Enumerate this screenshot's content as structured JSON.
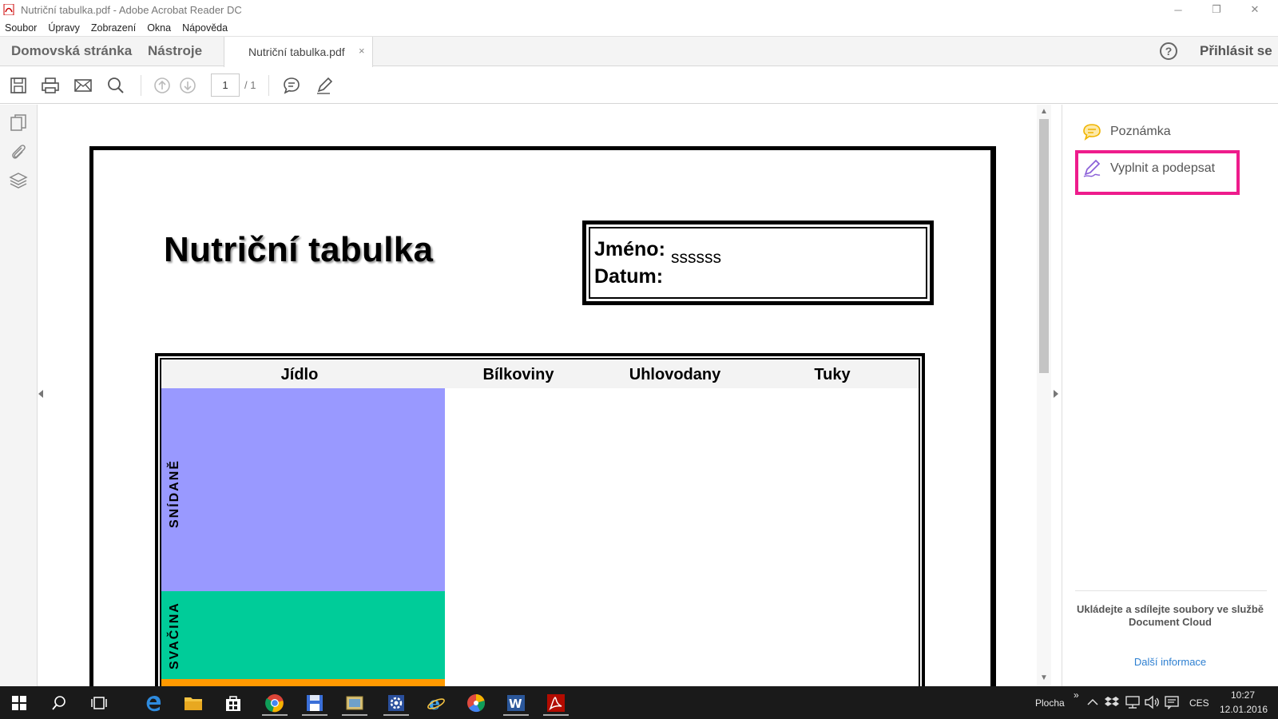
{
  "window": {
    "title": "Nutriční tabulka.pdf - Adobe Acrobat Reader DC",
    "controls": {
      "minimize": "─",
      "maximize": "❐",
      "close": "✕"
    }
  },
  "menu": [
    "Soubor",
    "Úpravy",
    "Zobrazení",
    "Okna",
    "Nápověda"
  ],
  "tabs": {
    "home": "Domovská stránka",
    "tools": "Nástroje",
    "document": "Nutriční tabulka.pdf",
    "close": "×",
    "help": "?",
    "signin": "Přihlásit se"
  },
  "toolbar": {
    "page_current": "1",
    "page_total": "/ 1"
  },
  "document": {
    "title": "Nutriční tabulka",
    "name_label": "Jméno:",
    "date_label": "Datum:",
    "name_value": "ssssss",
    "columns": [
      "Jídlo",
      "Bílkoviny",
      "Uhlovodany",
      "Tuky"
    ],
    "rows": [
      {
        "label": "SNÍDANĚ",
        "color": "#9999ff"
      },
      {
        "label": "SVAČINA",
        "color": "#00cc99"
      }
    ]
  },
  "right_panel": {
    "comment": "Poznámka",
    "fill_sign": "Vyplnit a podepsat",
    "highlight_color": "#ee1c8c",
    "footer": "Ukládejte a sdílejte soubory ve službě Document Cloud",
    "link": "Další informace"
  },
  "taskbar": {
    "desktop_label": "Plocha",
    "chevron": "»",
    "language": "CES",
    "time": "10:27",
    "date": "12.01.2016"
  }
}
